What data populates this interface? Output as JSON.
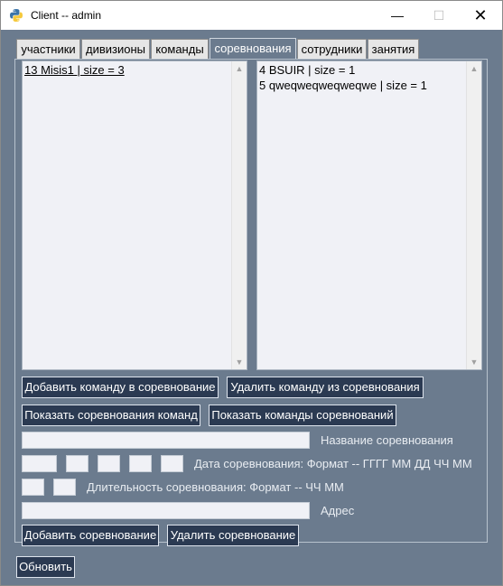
{
  "window": {
    "title": "Client -- admin",
    "min_glyph": "—",
    "max_glyph": "☐",
    "close_glyph": "✕"
  },
  "tabs": [
    {
      "label": "участники"
    },
    {
      "label": "дивизионы"
    },
    {
      "label": "команды"
    },
    {
      "label": "соревнования",
      "active": true
    },
    {
      "label": "сотрудники"
    },
    {
      "label": "занятия"
    }
  ],
  "left_list": {
    "items": [
      "13 Misis1 | size = 3"
    ]
  },
  "right_list": {
    "items": [
      "4 BSUIR | size = 1",
      "5 qweqweqweqweqwe | size = 1"
    ]
  },
  "scroll": {
    "up": "▲",
    "down": "▼"
  },
  "buttons": {
    "add_team": "Добавить команду в соревнование",
    "remove_team": "Удалить команду из соревнования",
    "show_comp_teams": "Показать соревнования команд",
    "show_teams_comp": "Показать команды соревнований",
    "add_comp": "Добавить соревнование",
    "delete_comp": "Удалить соревнование",
    "refresh": "Обновить"
  },
  "labels": {
    "name": "Название соревнования",
    "date": "Дата соревнования: Формат -- ГГГГ ММ ДД ЧЧ ММ",
    "duration": "Длительность соревнования: Формат -- ЧЧ ММ",
    "address": "Адрес"
  },
  "fields": {
    "name": "",
    "date_year": "",
    "date_month": "",
    "date_day": "",
    "date_hour": "",
    "date_minute": "",
    "duration_hours": "",
    "duration_minutes": "",
    "address": ""
  },
  "colors": {
    "background": "#6b7b8e",
    "button": "#2b3a52"
  }
}
